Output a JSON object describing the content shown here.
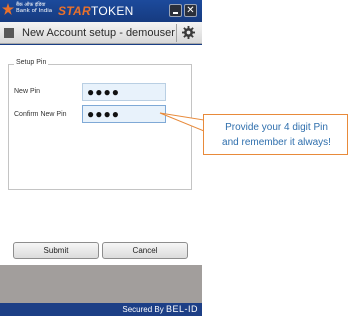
{
  "titlebar": {
    "bank_hindi": "बैंक ऑफ़ इंडिया",
    "bank_name": "Bank of India",
    "star_text": "STAR",
    "token_text": "TOKEN",
    "close_glyph": "✕"
  },
  "header": {
    "title": "New Account setup - demouser"
  },
  "form": {
    "legend": "Setup Pin",
    "new_pin_label": "New Pin",
    "new_pin_value": "●●●●",
    "confirm_pin_label": "Confirm New Pin",
    "confirm_pin_value": "●●●●"
  },
  "buttons": {
    "submit_label": "Submit",
    "cancel_label": "Cancel"
  },
  "footer": {
    "secured_by": "Secured By",
    "vendor": "BEL-ID"
  },
  "callout": {
    "line1": "Provide your 4 digit Pin",
    "line2": "and remember it always!"
  },
  "colors": {
    "app_blue": "#1a3f86",
    "star_orange": "#e9712c",
    "callout_border": "#e88a3a",
    "callout_text": "#2f6fad",
    "input_fill": "#e8f2fb"
  },
  "icons": [
    "bank-of-india-logo-icon",
    "minimize-icon",
    "close-icon",
    "menu-icon",
    "gear-icon"
  ]
}
